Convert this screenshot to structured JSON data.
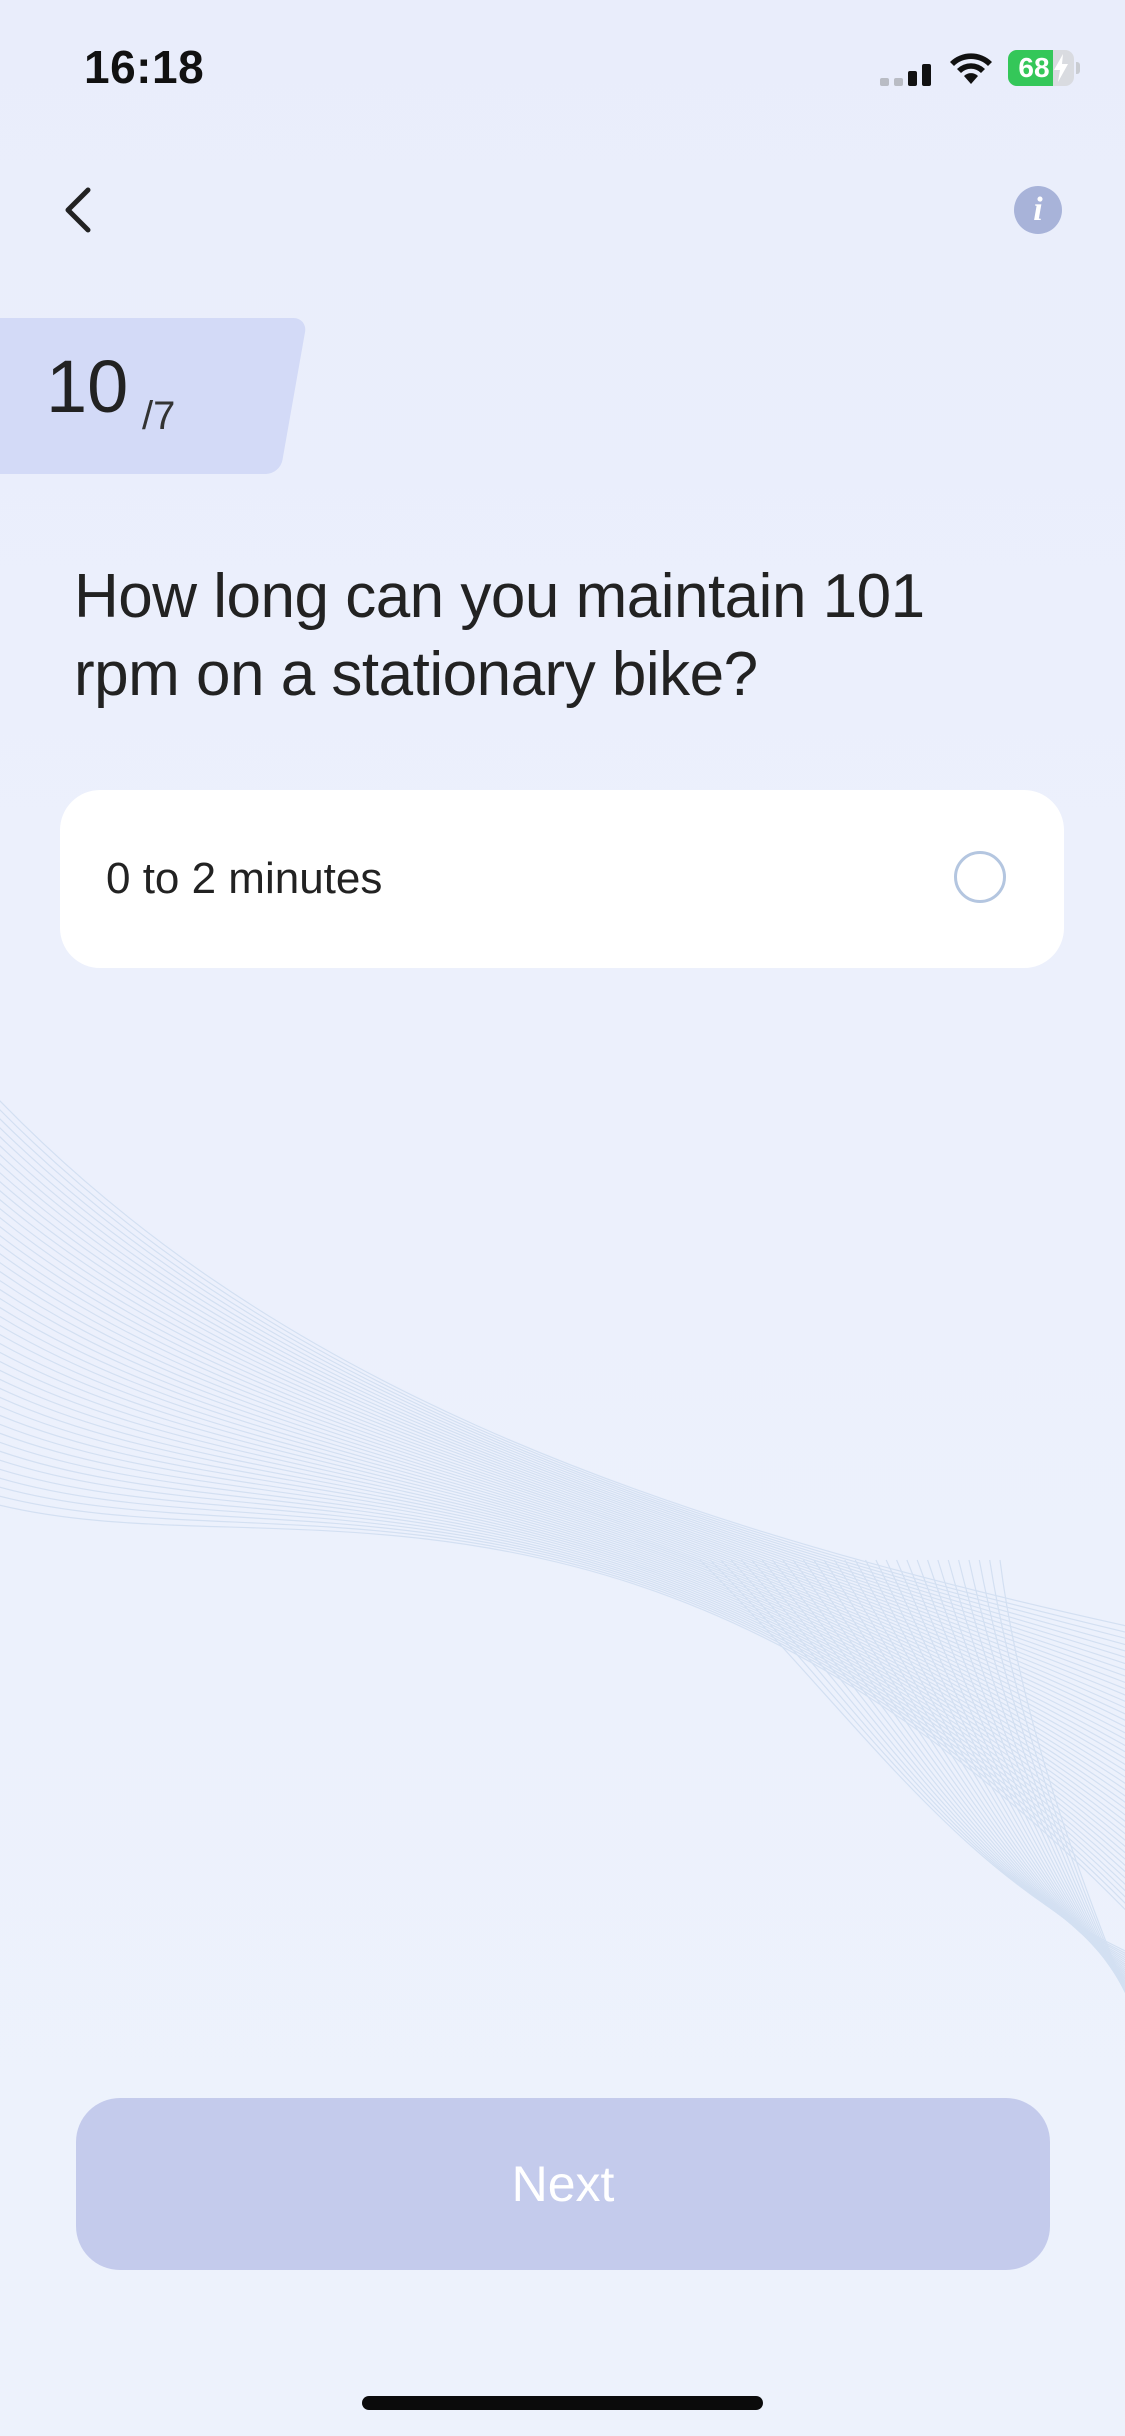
{
  "status_bar": {
    "time": "16:18",
    "battery_level": "68",
    "battery_fraction": 0.68,
    "charging": true,
    "icons": [
      "signal-icon",
      "wifi-icon",
      "battery-icon",
      "bolt-icon"
    ]
  },
  "nav": {
    "back_icon": "chevron-left-icon",
    "info_icon": "info-icon",
    "info_glyph": "i"
  },
  "step": {
    "current": "10",
    "total": "/7"
  },
  "question": {
    "text": "How long can you maintain 101 rpm on a stationary bike?"
  },
  "options": [
    {
      "label": "0 to 2 minutes",
      "selected": false
    }
  ],
  "next_button": {
    "label": "Next",
    "enabled": false
  },
  "colors": {
    "background": "#ecf0fc",
    "step_badge": "#d3daf7",
    "option_bg": "#ffffff",
    "radio_border": "#b4c6e0",
    "next_button_disabled": "#c4cbec",
    "info_icon_bg": "#a8b3d9",
    "battery_green": "#34c759"
  }
}
